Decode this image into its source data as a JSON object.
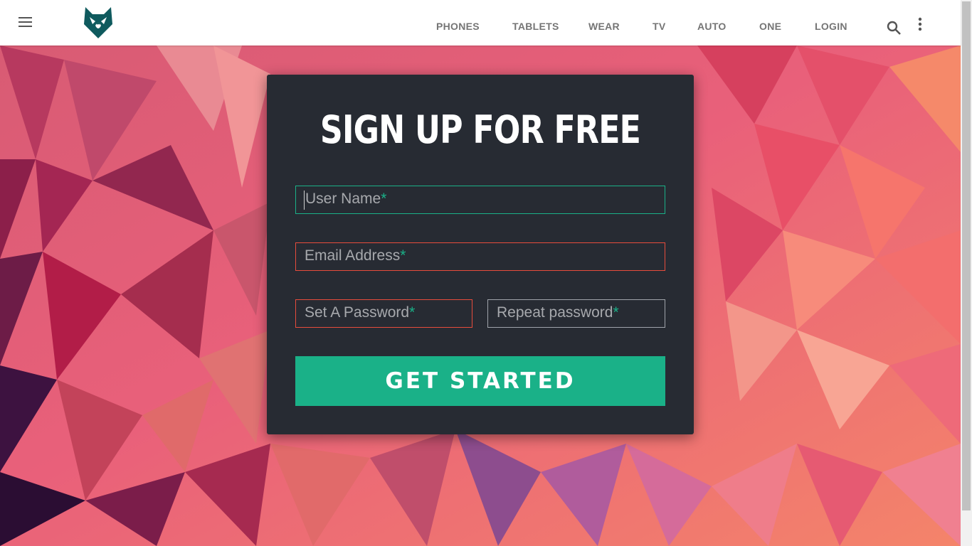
{
  "nav": {
    "items": [
      "PHONES",
      "TABLETS",
      "WEAR",
      "TV",
      "AUTO",
      "ONE",
      "LOGIN"
    ],
    "menu_icon": "hamburger-menu-icon",
    "logo_icon": "wolf-logo-icon",
    "search_icon": "search-icon",
    "more_icon": "more-vertical-icon",
    "text_color": "#757575"
  },
  "signup": {
    "title": "SIGN UP FOR FREE",
    "username_placeholder": "User Name",
    "email_placeholder": "Email Address",
    "password_placeholder": "Set A Password",
    "repeat_placeholder": "Repeat password",
    "required_marker": "*",
    "submit_label": "GET STARTED"
  },
  "colors": {
    "card_background": "#272b33",
    "accent": "#1ab188",
    "error": "#e74c3c",
    "placeholder": "#a7a9ad"
  }
}
